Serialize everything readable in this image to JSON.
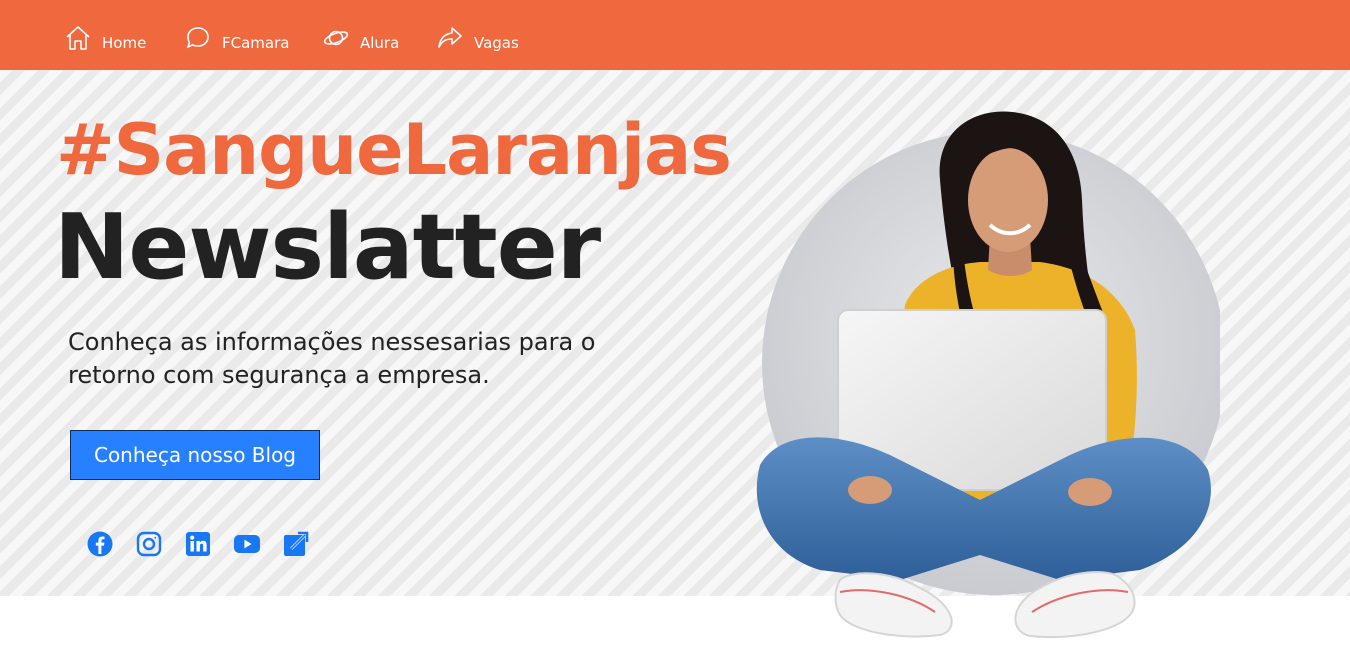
{
  "nav": {
    "items": [
      {
        "label": "Home",
        "icon": "home-icon"
      },
      {
        "label": "FCamara",
        "icon": "chat-icon"
      },
      {
        "label": "Alura",
        "icon": "planet-icon"
      },
      {
        "label": "Vagas",
        "icon": "share-arrow-icon"
      }
    ]
  },
  "hero": {
    "hashtag": "#SangueLaranjas",
    "title": "Newslatter",
    "description": "Conheça as informações nessesarias para o retorno com segurança a empresa.",
    "cta_label": "Conheça nosso Blog"
  },
  "socials": [
    "facebook-icon",
    "instagram-icon",
    "linkedin-icon",
    "youtube-icon",
    "external-link-icon"
  ],
  "colors": {
    "brand_orange": "#EF683E",
    "cta_blue": "#2680FF",
    "text_dark": "#222222",
    "social_blue": "#1877F2"
  }
}
